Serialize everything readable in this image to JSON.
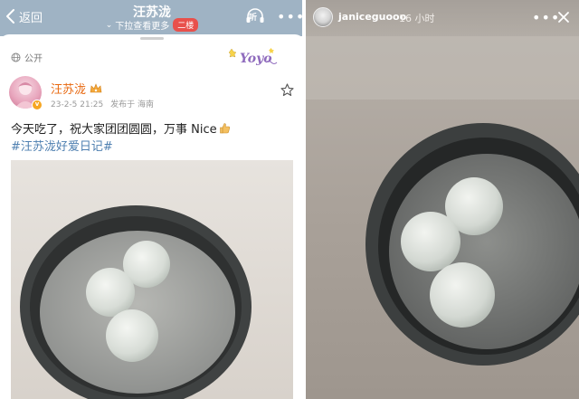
{
  "left_panel": {
    "nav": {
      "back_label": "返回",
      "title": "汪苏泷",
      "subtitle": "下拉查看更多",
      "floor_badge": "二楼",
      "listen_icon_text": "听"
    },
    "post": {
      "visibility": "公开",
      "sticker_text": "Yoyo",
      "author": "汪苏泷",
      "verified_badge": "v",
      "timestamp": "23-2-5 21:25",
      "location": "发布于 海南",
      "text": "今天吃了，祝大家团团圆圆，万事 Nice",
      "hashtag": "#汪苏泷好爱日记#"
    }
  },
  "right_panel": {
    "story": {
      "username": "janiceguooo",
      "time_ago": "16 小时"
    }
  },
  "colors": {
    "nav_bg": "#9fb3c4",
    "author_orange": "#e8680f",
    "hashtag_blue": "#4e7fb0",
    "badge_red": "#e8504b"
  }
}
